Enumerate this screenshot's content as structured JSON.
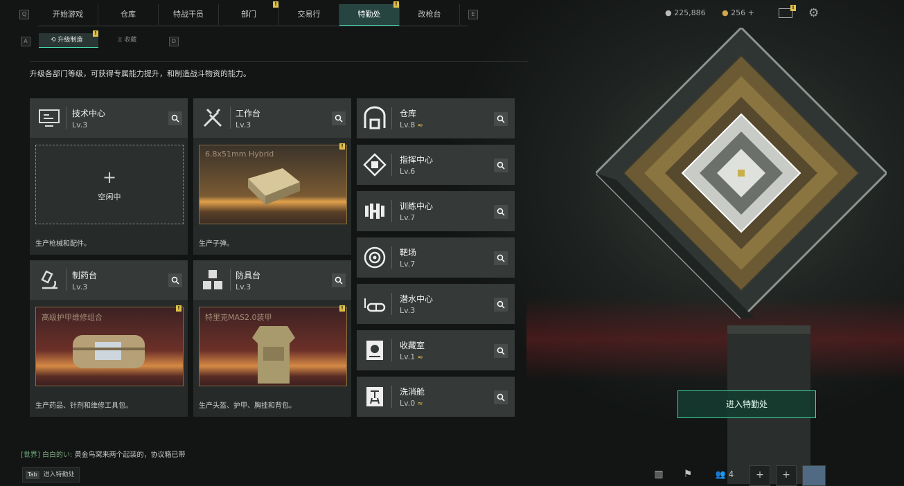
{
  "top_tabs": [
    {
      "label": "开始游戏",
      "badge": ""
    },
    {
      "label": "仓库",
      "badge": ""
    },
    {
      "label": "特战干员",
      "badge": ""
    },
    {
      "label": "部门",
      "badge": "!"
    },
    {
      "label": "交易行",
      "badge": ""
    },
    {
      "label": "特勤处",
      "badge": "!"
    },
    {
      "label": "改枪台",
      "badge": ""
    }
  ],
  "keys": {
    "left": "Q",
    "right": "E",
    "sub_left": "A",
    "sub_right": "D"
  },
  "resources": {
    "coins": "225,886",
    "premium": "256",
    "plus": "+"
  },
  "mail_badge": "!",
  "sub_tabs": [
    {
      "label": "升级制造",
      "badge": "!"
    },
    {
      "label": "收藏",
      "badge": ""
    }
  ],
  "description": "升级各部门等级，可获得专属能力提升，和制造战斗物资的能力。",
  "production_cards": [
    {
      "title": "技术中心",
      "level": "Lv.3",
      "state": "空闲中",
      "state_icon": "+",
      "footer": "生产枪械和配件。",
      "product": "",
      "badge": ""
    },
    {
      "title": "工作台",
      "level": "Lv.3",
      "product": "6.8x51mm Hybrid",
      "footer": "生产子弹。",
      "badge": "!"
    },
    {
      "title": "制药台",
      "level": "Lv.3",
      "product": "高级护甲维修组合",
      "footer": "生产药品、针剂和维修工具包。",
      "badge": "!"
    },
    {
      "title": "防具台",
      "level": "Lv.3",
      "product": "特里克MAS2.0装甲",
      "footer": "生产头盔、护甲、胸挂和背包。",
      "badge": "!"
    }
  ],
  "facilities": [
    {
      "title": "仓库",
      "level": "Lv.8",
      "upgrade": "≈",
      "icon": "warehouse-icon"
    },
    {
      "title": "指挥中心",
      "level": "Lv.6",
      "upgrade": "",
      "icon": "command-center-icon"
    },
    {
      "title": "训练中心",
      "level": "Lv.7",
      "upgrade": "",
      "icon": "dumbbell-icon"
    },
    {
      "title": "靶场",
      "level": "Lv.7",
      "upgrade": "",
      "icon": "target-icon"
    },
    {
      "title": "潜水中心",
      "level": "Lv.3",
      "upgrade": "",
      "icon": "diving-goggles-icon"
    },
    {
      "title": "收藏室",
      "level": "Lv.1",
      "upgrade": "≈",
      "icon": "collection-room-icon"
    },
    {
      "title": "洗消舱",
      "level": "Lv.0",
      "upgrade": "≈",
      "icon": "decontamination-icon"
    }
  ],
  "enter_button": "进入特勤处",
  "chat": {
    "channel": "[世界]",
    "user": "白白的い:",
    "message": "黄金鸟窝来两个起装的，协议箱已带"
  },
  "tab_hint": {
    "key": "Tab",
    "label": "进入特勤处"
  },
  "bottom_bar": {
    "squad_count": "4",
    "plus": "+"
  },
  "colors": {
    "accent": "#46e0b0",
    "badge": "#e0c24a",
    "upgrade": "#e6b84a"
  }
}
